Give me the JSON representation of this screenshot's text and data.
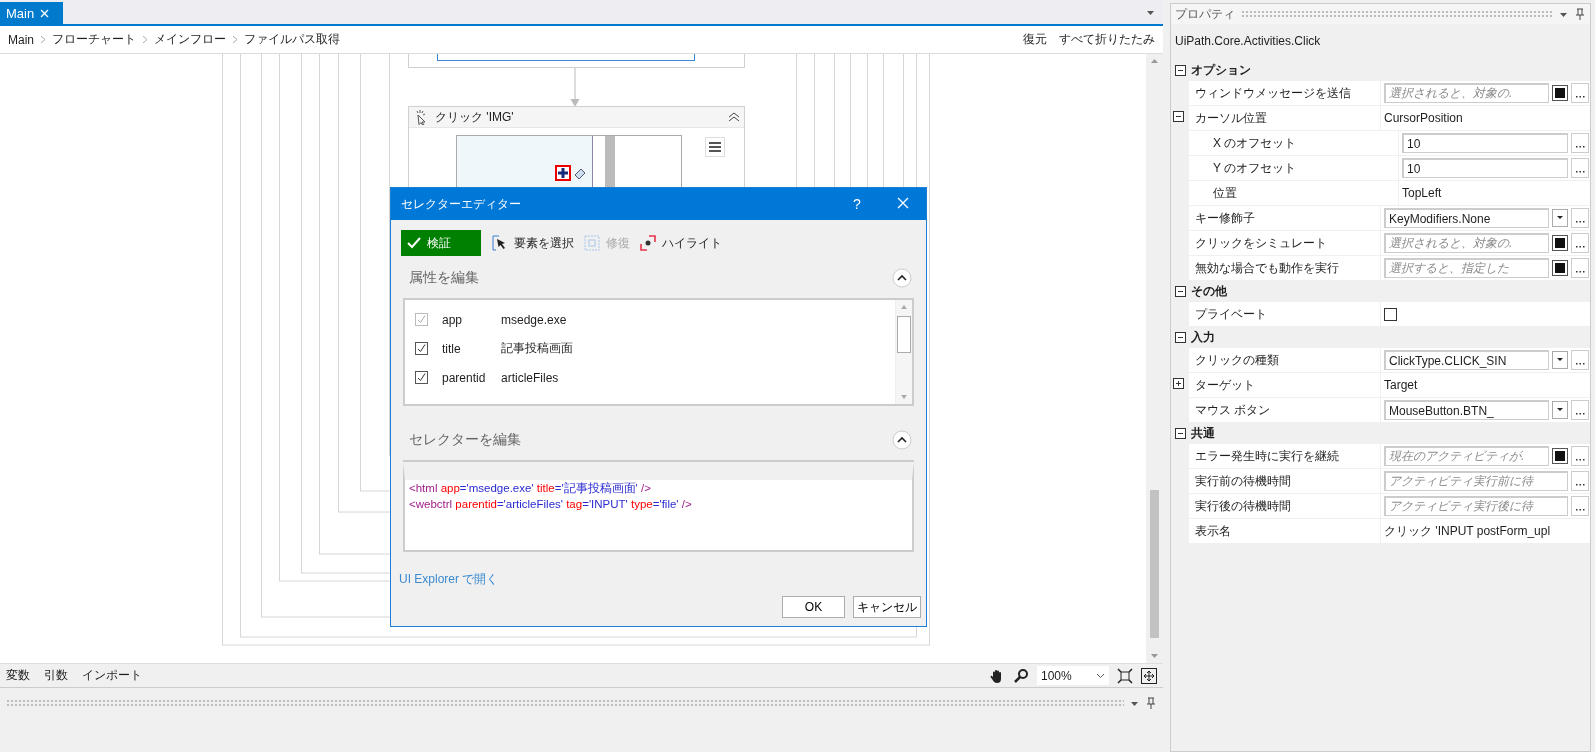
{
  "tabs": [
    {
      "label": "Main",
      "selected": true
    }
  ],
  "breadcrumb": [
    "Main",
    "フローチャート",
    "メインフロー",
    "ファイルパス取得"
  ],
  "designer_actions": [
    "復元",
    "すべて折りたたみ"
  ],
  "activity": {
    "title": "クリック 'IMG'",
    "expanded": true
  },
  "bottom_bar": {
    "tabs": [
      "変数",
      "引数",
      "インポート"
    ],
    "zoom": "100%"
  },
  "selector_editor": {
    "title": "セレクターエディター",
    "help": "?",
    "toolbar": [
      {
        "kind": "validate",
        "label": "検証",
        "disabled": false
      },
      {
        "kind": "pick",
        "label": "要素を選択",
        "disabled": false
      },
      {
        "kind": "repair",
        "label": "修復",
        "disabled": true
      },
      {
        "kind": "highlight",
        "label": "ハイライト",
        "disabled": false
      }
    ],
    "attributes": {
      "title": "属性を編集",
      "expanded": true,
      "rows": [
        {
          "name": "app",
          "value": "msedge.exe",
          "checked": true,
          "disabled": true
        },
        {
          "name": "title",
          "value": "記事投稿画面",
          "checked": true,
          "disabled": false
        },
        {
          "name": "parentid",
          "value": "articleFiles",
          "checked": true,
          "disabled": false
        }
      ]
    },
    "selector": {
      "title": "セレクターを編集",
      "expanded": true,
      "lines": [
        [
          {
            "kind": "tag",
            "text": "<html "
          },
          {
            "kind": "attr",
            "text": "app"
          },
          {
            "kind": "value",
            "text": "='msedge.exe' "
          },
          {
            "kind": "attr",
            "text": "title"
          },
          {
            "kind": "value",
            "text": "='記事投稿画面' "
          },
          {
            "kind": "tag",
            "text": "/>"
          }
        ],
        [
          {
            "kind": "tag",
            "text": "<webctrl "
          },
          {
            "kind": "attr",
            "text": "parentid"
          },
          {
            "kind": "value",
            "text": "='articleFiles' "
          },
          {
            "kind": "attr",
            "text": "tag"
          },
          {
            "kind": "value",
            "text": "='INPUT' "
          },
          {
            "kind": "attr",
            "text": "type"
          },
          {
            "kind": "value",
            "text": "='file' "
          },
          {
            "kind": "tag",
            "text": "/>"
          }
        ]
      ]
    },
    "link": "UI Explorer で開く",
    "buttons": [
      "OK",
      "キャンセル"
    ]
  },
  "properties": {
    "title": "プロパティ",
    "type": "UiPath.Core.Activities.Click",
    "categories": [
      {
        "name": "オプション",
        "expanded": true,
        "rows": [
          {
            "kind": "flag",
            "label": "ウィンドウメッセージを送信",
            "placeholder": "選択されると、対象の."
          },
          {
            "kind": "group",
            "label": "カーソル位置",
            "value": "CursorPosition",
            "expanded": true,
            "children": [
              {
                "kind": "input",
                "label": "X のオフセット",
                "value": "10"
              },
              {
                "kind": "input",
                "label": "Y のオフセット",
                "value": "10"
              },
              {
                "kind": "text",
                "label": "位置",
                "value": "TopLeft"
              }
            ]
          },
          {
            "kind": "dropdown",
            "label": "キー修飾子",
            "value": "KeyModifiers.None"
          },
          {
            "kind": "flag",
            "label": "クリックをシミュレート",
            "placeholder": "選択されると、対象の."
          },
          {
            "kind": "flag",
            "label": "無効な場合でも動作を実行",
            "placeholder": "選択すると、指定した"
          }
        ]
      },
      {
        "name": "その他",
        "expanded": true,
        "rows": [
          {
            "kind": "checkbox",
            "label": "プライベート",
            "checked": false
          }
        ]
      },
      {
        "name": "入力",
        "expanded": true,
        "rows": [
          {
            "kind": "dropdown",
            "label": "クリックの種類",
            "value": "ClickType.CLICK_SIN"
          },
          {
            "kind": "group",
            "label": "ターゲット",
            "value": "Target",
            "expanded": false
          },
          {
            "kind": "dropdown",
            "label": "マウス ボタン",
            "value": "MouseButton.BTN_"
          }
        ]
      },
      {
        "name": "共通",
        "expanded": true,
        "rows": [
          {
            "kind": "flag",
            "label": "エラー発生時に実行を継続",
            "placeholder": "現在のアクティビティが."
          },
          {
            "kind": "expression",
            "label": "実行前の待機時間",
            "placeholder": "アクティビティ実行前に待"
          },
          {
            "kind": "expression",
            "label": "実行後の待機時間",
            "placeholder": "アクティビティ実行後に待"
          },
          {
            "kind": "text",
            "label": "表示名",
            "value": "クリック 'INPUT  postForm_upl"
          }
        ]
      }
    ]
  }
}
